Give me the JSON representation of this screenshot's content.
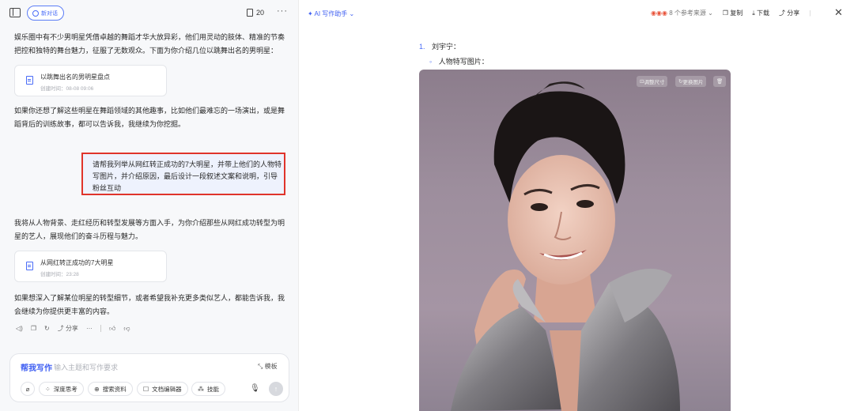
{
  "left_header": {
    "new_chat_label": "新对话",
    "doc_count": "20",
    "more": "···"
  },
  "chat": {
    "intro_text": "娱乐圈中有不少男明星凭借卓越的舞蹈才华大放异彩，他们用灵动的肢体、精准的节奏把控和独特的舞台魅力，征服了无数观众。下面为你介绍几位以跳舞出名的男明星：",
    "card1": {
      "title": "以跳舞出名的男明星盘点",
      "date": "创建时间：08-08 09:06"
    },
    "followup_text": "如果你还想了解这些明星在舞蹈领域的其他趣事，比如他们最难忘的一场演出，或是舞蹈背后的训练故事，都可以告诉我，我继续为你挖掘。",
    "user_message": "请帮我列举从网红转正成功的7大明星，并带上他们的人物特写图片，并介绍原因，最后设计一段叙述文案和说明，引导粉丝互动",
    "reply_text": "我将从人物背景、走红经历和转型发展等方面入手，为你介绍那些从网红成功转型为明星的艺人，展现他们的奋斗历程与魅力。",
    "card2": {
      "title": "从网红转正成功的7大明星",
      "date": "创建时间：23:28"
    },
    "closing_text": "如果想深入了解某位明星的转型细节，或者希望我补充更多类似艺人，都能告诉我，我会继续为你提供更丰富的内容。",
    "actions": {
      "share_label": "分享",
      "more": "···"
    }
  },
  "composer": {
    "mode_label": "帮我写作",
    "placeholder": "输入主题和写作要求",
    "template_label": "模板",
    "tools": [
      "深度思考",
      "搜索资料",
      "文档编辑器",
      "技能"
    ]
  },
  "right_header": {
    "ai_assist_label": "AI 写作助手",
    "refs_label": "8 个参考来源",
    "copy_label": "复制",
    "download_label": "下载",
    "share_label": "分享"
  },
  "document": {
    "item_number": "1.",
    "item_title": "刘宇宁：",
    "sub_item": "人物特写图片：",
    "image_buttons": [
      "调整尺寸",
      "更换图片"
    ]
  }
}
